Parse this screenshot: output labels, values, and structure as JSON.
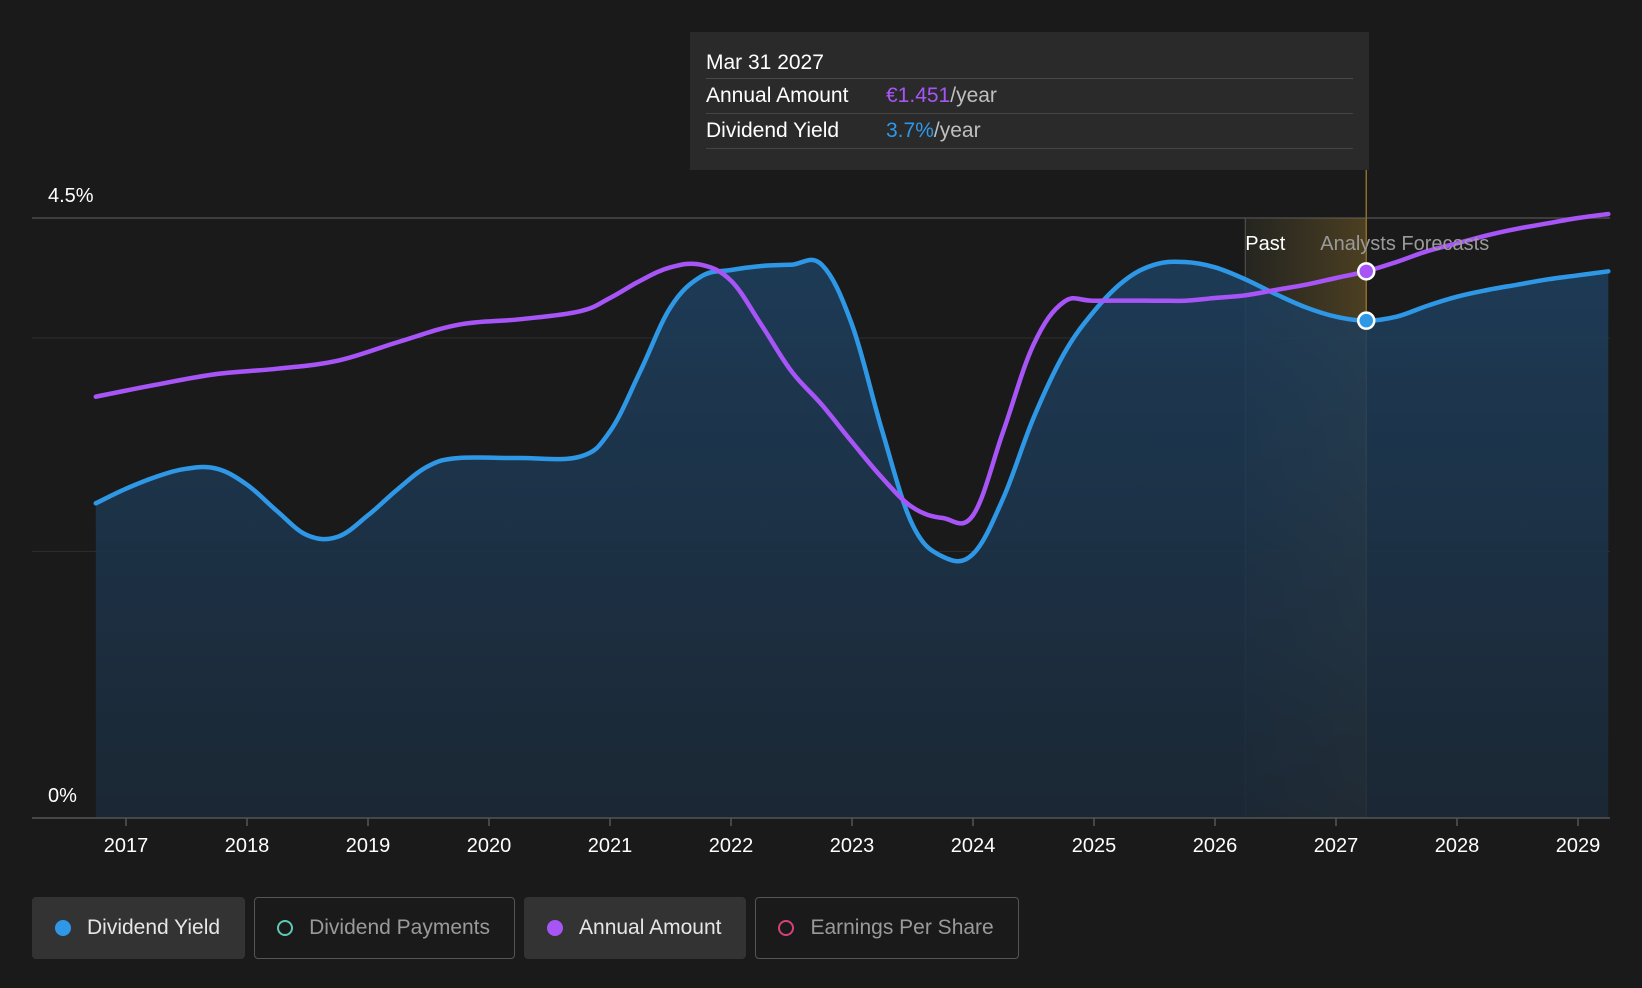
{
  "tooltip": {
    "date": "Mar 31 2027",
    "rows": [
      {
        "label": "Annual Amount",
        "value": "€1.451",
        "unit": "/year"
      },
      {
        "label": "Dividend Yield",
        "value": "3.7%",
        "unit": "/year"
      }
    ]
  },
  "regions": {
    "past_label": "Past",
    "forecast_label": "Analysts Forecasts"
  },
  "legend": [
    {
      "label": "Dividend Yield",
      "color": "#2f98e6",
      "active": true,
      "filled": true
    },
    {
      "label": "Dividend Payments",
      "color": "#5ec9b5",
      "active": false,
      "filled": false
    },
    {
      "label": "Annual Amount",
      "color": "#a855f7",
      "active": true,
      "filled": true
    },
    {
      "label": "Earnings Per Share",
      "color": "#d6407b",
      "active": false,
      "filled": false
    }
  ],
  "chart_data": {
    "type": "line",
    "title": "",
    "xlabel": "",
    "ylabel": "",
    "y_tick_labels": [
      {
        "value": 4.5,
        "label": "4.5%"
      },
      {
        "value": 0,
        "label": "0%"
      }
    ],
    "ylim": [
      0,
      4.5
    ],
    "xlim": [
      2016.5,
      2029.3
    ],
    "x_ticks": [
      2017,
      2018,
      2019,
      2020,
      2021,
      2022,
      2023,
      2024,
      2025,
      2026,
      2027,
      2028,
      2029
    ],
    "grid": true,
    "past_end": 2026.25,
    "highlight_date": 2027.25,
    "series": [
      {
        "name": "Dividend Yield",
        "color": "#2f98e6",
        "area": true,
        "points": [
          [
            2016.75,
            2.36
          ],
          [
            2017.0,
            2.47
          ],
          [
            2017.25,
            2.56
          ],
          [
            2017.5,
            2.62
          ],
          [
            2017.75,
            2.62
          ],
          [
            2018.0,
            2.5
          ],
          [
            2018.25,
            2.3
          ],
          [
            2018.5,
            2.12
          ],
          [
            2018.75,
            2.11
          ],
          [
            2019.0,
            2.27
          ],
          [
            2019.25,
            2.47
          ],
          [
            2019.5,
            2.64
          ],
          [
            2019.75,
            2.7
          ],
          [
            2020.25,
            2.7
          ],
          [
            2020.75,
            2.71
          ],
          [
            2021.0,
            2.9
          ],
          [
            2021.25,
            3.35
          ],
          [
            2021.5,
            3.83
          ],
          [
            2021.75,
            4.06
          ],
          [
            2022.0,
            4.11
          ],
          [
            2022.25,
            4.14
          ],
          [
            2022.5,
            4.15
          ],
          [
            2022.75,
            4.15
          ],
          [
            2023.0,
            3.7
          ],
          [
            2023.25,
            2.9
          ],
          [
            2023.5,
            2.2
          ],
          [
            2023.75,
            1.96
          ],
          [
            2024.0,
            1.98
          ],
          [
            2024.25,
            2.4
          ],
          [
            2024.5,
            3.0
          ],
          [
            2024.75,
            3.48
          ],
          [
            2025.0,
            3.8
          ],
          [
            2025.25,
            4.03
          ],
          [
            2025.5,
            4.15
          ],
          [
            2025.75,
            4.17
          ],
          [
            2026.0,
            4.13
          ],
          [
            2026.25,
            4.04
          ],
          [
            2026.5,
            3.93
          ],
          [
            2026.75,
            3.83
          ],
          [
            2027.0,
            3.76
          ],
          [
            2027.25,
            3.73
          ],
          [
            2027.5,
            3.76
          ],
          [
            2027.75,
            3.84
          ],
          [
            2028.0,
            3.91
          ],
          [
            2028.25,
            3.96
          ],
          [
            2028.5,
            4.0
          ],
          [
            2028.75,
            4.04
          ],
          [
            2029.0,
            4.07
          ],
          [
            2029.25,
            4.1
          ]
        ]
      },
      {
        "name": "Annual Amount",
        "color": "#a855f7",
        "area": false,
        "points": [
          [
            2016.75,
            3.16
          ],
          [
            2017.25,
            3.25
          ],
          [
            2017.75,
            3.33
          ],
          [
            2018.25,
            3.37
          ],
          [
            2018.75,
            3.43
          ],
          [
            2019.25,
            3.57
          ],
          [
            2019.75,
            3.7
          ],
          [
            2020.25,
            3.74
          ],
          [
            2020.75,
            3.8
          ],
          [
            2021.0,
            3.9
          ],
          [
            2021.25,
            4.03
          ],
          [
            2021.5,
            4.13
          ],
          [
            2021.75,
            4.15
          ],
          [
            2022.0,
            4.03
          ],
          [
            2022.25,
            3.7
          ],
          [
            2022.5,
            3.35
          ],
          [
            2022.75,
            3.1
          ],
          [
            2023.0,
            2.82
          ],
          [
            2023.25,
            2.55
          ],
          [
            2023.5,
            2.33
          ],
          [
            2023.75,
            2.25
          ],
          [
            2024.0,
            2.27
          ],
          [
            2024.25,
            2.9
          ],
          [
            2024.5,
            3.55
          ],
          [
            2024.75,
            3.87
          ],
          [
            2025.0,
            3.88
          ],
          [
            2025.5,
            3.88
          ],
          [
            2025.75,
            3.88
          ],
          [
            2026.0,
            3.9
          ],
          [
            2026.25,
            3.92
          ],
          [
            2026.5,
            3.96
          ],
          [
            2026.75,
            4.0
          ],
          [
            2027.0,
            4.05
          ],
          [
            2027.25,
            4.1
          ],
          [
            2027.5,
            4.17
          ],
          [
            2027.75,
            4.25
          ],
          [
            2028.0,
            4.31
          ],
          [
            2028.25,
            4.37
          ],
          [
            2028.5,
            4.42
          ],
          [
            2028.75,
            4.46
          ],
          [
            2029.0,
            4.5
          ],
          [
            2029.25,
            4.53
          ]
        ]
      }
    ]
  }
}
